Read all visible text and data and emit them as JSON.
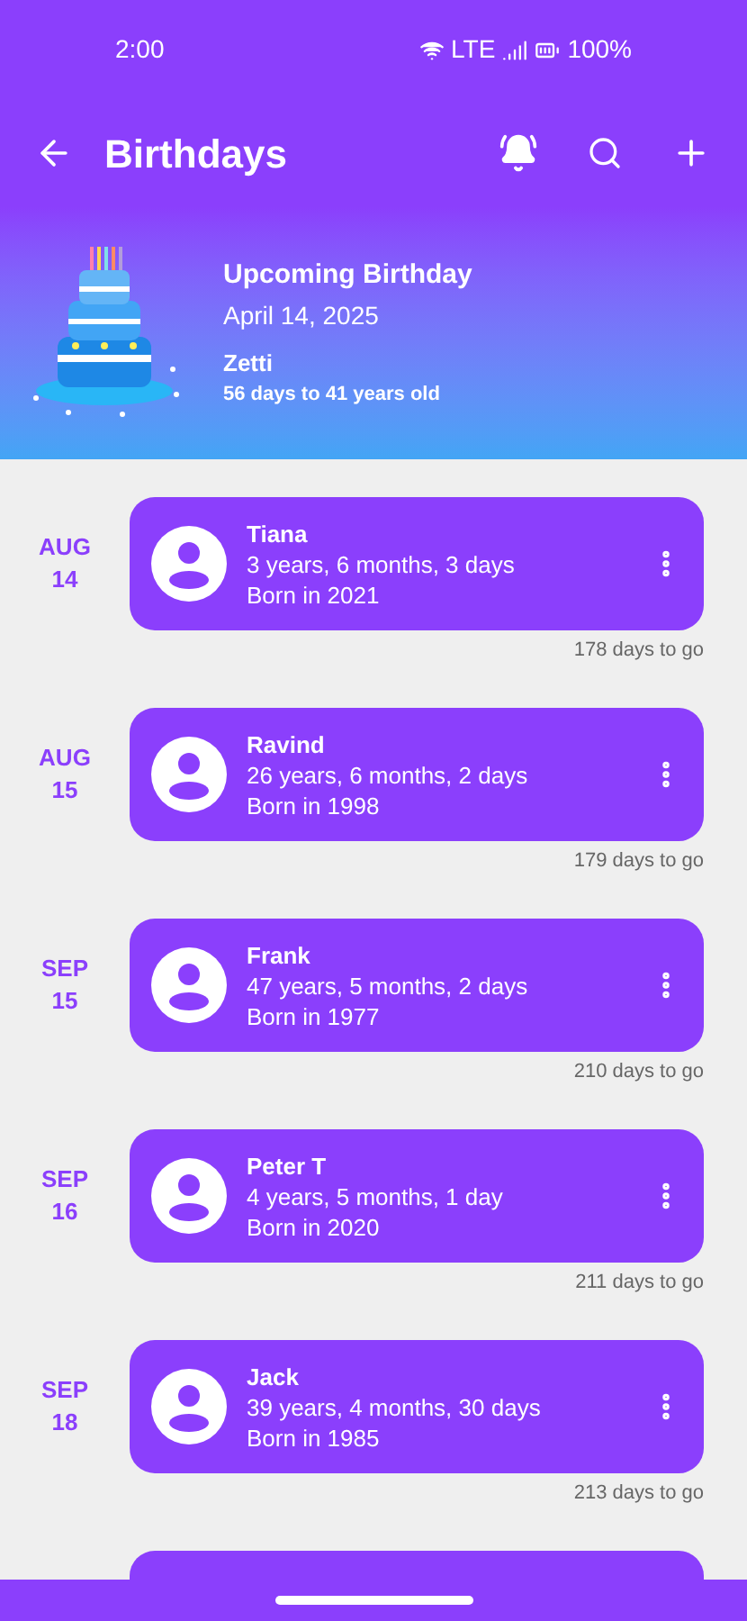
{
  "status_bar": {
    "time": "2:00",
    "network": "LTE",
    "battery": "100%"
  },
  "app_bar": {
    "title": "Birthdays"
  },
  "upcoming": {
    "heading": "Upcoming Birthday",
    "date": "April 14, 2025",
    "name": "Zetti",
    "detail": "56 days to 41 years old"
  },
  "birthdays": [
    {
      "month": "AUG",
      "day": "14",
      "name": "Tiana",
      "age": "3 years, 6 months, 3 days",
      "born": "Born in 2021",
      "countdown": "178 days to go"
    },
    {
      "month": "AUG",
      "day": "15",
      "name": "Ravind",
      "age": "26 years, 6 months, 2 days",
      "born": "Born in 1998",
      "countdown": "179 days to go"
    },
    {
      "month": "SEP",
      "day": "15",
      "name": "Frank",
      "age": "47 years, 5 months, 2 days",
      "born": "Born in 1977",
      "countdown": "210 days to go"
    },
    {
      "month": "SEP",
      "day": "16",
      "name": "Peter T",
      "age": "4 years, 5 months, 1 day",
      "born": "Born in 2020",
      "countdown": "211 days to go"
    },
    {
      "month": "SEP",
      "day": "18",
      "name": "Jack",
      "age": "39 years, 4 months, 30 days",
      "born": "Born in 1985",
      "countdown": "213 days to go"
    }
  ]
}
